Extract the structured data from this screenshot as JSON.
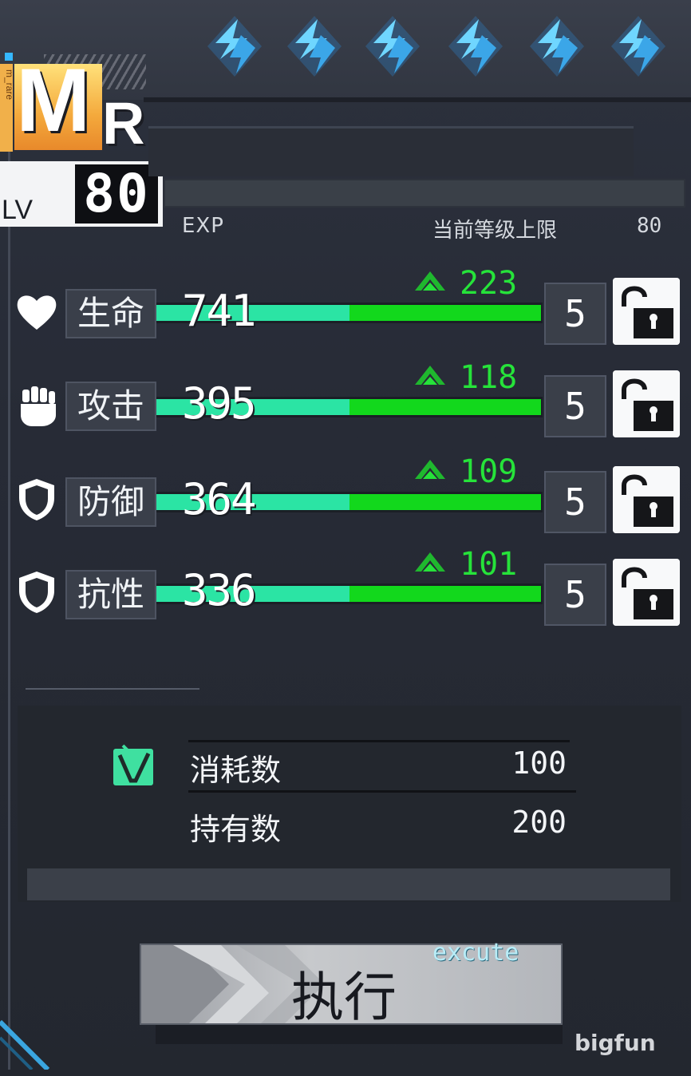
{
  "rank": {
    "main": "M",
    "sub": "R",
    "side": "m_rare"
  },
  "level": {
    "label": "LV",
    "value": "80"
  },
  "exp": {
    "label": "EXP",
    "cap_label": "当前等级上限",
    "cap_value": "80"
  },
  "stats": [
    {
      "label": "生命",
      "icon": "heart-icon",
      "value": "741",
      "bonus": "223",
      "level": "5"
    },
    {
      "label": "攻击",
      "icon": "fist-icon",
      "value": "395",
      "bonus": "118",
      "level": "5"
    },
    {
      "label": "防御",
      "icon": "shield-icon",
      "value": "364",
      "bonus": "109",
      "level": "5"
    },
    {
      "label": "抗性",
      "icon": "shield-icon",
      "value": "336",
      "bonus": "101",
      "level": "5"
    }
  ],
  "cost": {
    "consume_label": "消耗数",
    "consume_value": "100",
    "owned_label": "持有数",
    "owned_value": "200"
  },
  "execute": {
    "label": "执行",
    "sub_label": "excute"
  },
  "watermark": "bigfun",
  "colors": {
    "accent_green": "#12d81c",
    "accent_cyan": "#2be4a4",
    "rank_gold": "#f4a93c",
    "gem_blue": "#5ecfff"
  }
}
